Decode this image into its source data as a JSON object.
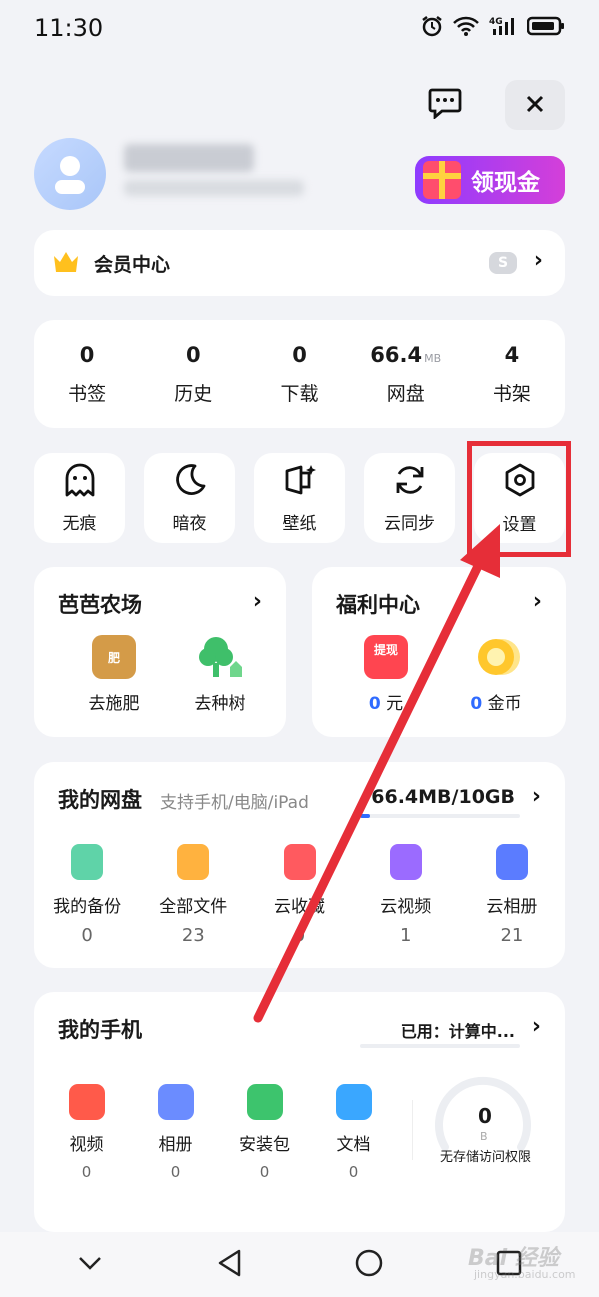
{
  "status_bar": {
    "time": "11:30",
    "network": "4G"
  },
  "profile": {
    "cash_button": "领现金"
  },
  "vip": {
    "label": "会员中心",
    "badge": "S"
  },
  "stats": [
    {
      "value": "0",
      "unit": "",
      "label": "书签"
    },
    {
      "value": "0",
      "unit": "",
      "label": "历史"
    },
    {
      "value": "0",
      "unit": "",
      "label": "下载"
    },
    {
      "value": "66.4",
      "unit": "MB",
      "label": "网盘"
    },
    {
      "value": "4",
      "unit": "",
      "label": "书架"
    }
  ],
  "tools": [
    {
      "label": "无痕",
      "icon": "ghost-icon"
    },
    {
      "label": "暗夜",
      "icon": "moon-icon"
    },
    {
      "label": "壁纸",
      "icon": "wallpaper-icon"
    },
    {
      "label": "云同步",
      "icon": "sync-icon"
    },
    {
      "label": "设置",
      "icon": "settings-icon"
    }
  ],
  "farm": {
    "title": "芭芭农场",
    "items": [
      {
        "label": "去施肥",
        "icon_text": "肥"
      },
      {
        "label": "去种树"
      }
    ]
  },
  "welfare": {
    "title": "福利中心",
    "items": [
      {
        "value": "0",
        "label": "元",
        "icon_text": "提现"
      },
      {
        "value": "0",
        "label": "金币"
      }
    ]
  },
  "disk": {
    "title": "我的网盘",
    "subtitle": "支持手机/电脑/iPad",
    "usage": "66.4MB/10GB",
    "usage_fraction": 0.0065,
    "items": [
      {
        "label": "我的备份",
        "count": "0",
        "color": "#5fd3a8"
      },
      {
        "label": "全部文件",
        "count": "23",
        "color": "#ffb23f"
      },
      {
        "label": "云收藏",
        "count": "0",
        "color": "#ff5a5f"
      },
      {
        "label": "云视频",
        "count": "1",
        "color": "#9b6bff"
      },
      {
        "label": "云相册",
        "count": "21",
        "color": "#5b7cff"
      }
    ]
  },
  "phone": {
    "title": "我的手机",
    "used": "已用：计算中...",
    "items": [
      {
        "label": "视频",
        "count": "0",
        "color": "#ff5a4a"
      },
      {
        "label": "相册",
        "count": "0",
        "color": "#6b8cff"
      },
      {
        "label": "安装包",
        "count": "0",
        "color": "#3dc46d"
      },
      {
        "label": "文档",
        "count": "0",
        "color": "#3aa7ff"
      }
    ],
    "storage_value": "0",
    "storage_unit": "B",
    "no_permission": "无存储访问权限"
  },
  "watermark": {
    "text": "Bai 经验",
    "sub": "jingyan.baidu.com"
  },
  "accent": {
    "highlight": "#e62e38",
    "link": "#2f6bff"
  }
}
